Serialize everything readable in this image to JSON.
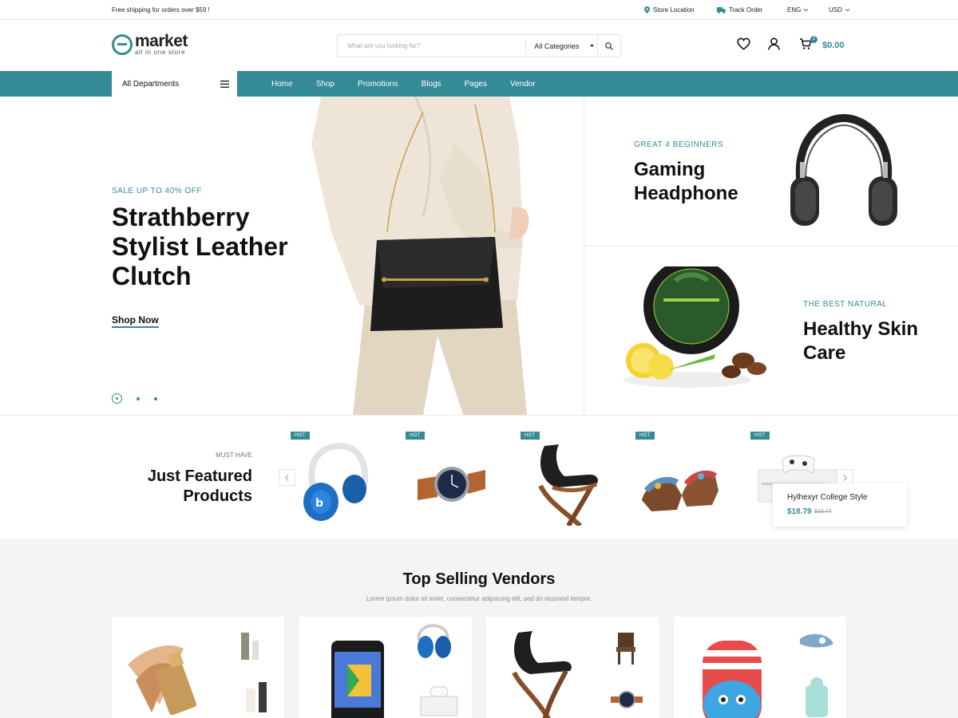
{
  "topbar": {
    "shipping": "Free shipping for orders over $59 !",
    "store_location": "Store Location",
    "track_order": "Track Order",
    "language": "ENG",
    "currency": "USD"
  },
  "header": {
    "logo_title": "market",
    "logo_sub": "all in one store",
    "search_placeholder": "What are you looking for?",
    "search_category": "All Categories",
    "cart_count": "2",
    "cart_total": "$0.00"
  },
  "nav": {
    "departments": "All Departments",
    "links": [
      "Home",
      "Shop",
      "Promotions",
      "Blogs",
      "Pages",
      "Vendor"
    ]
  },
  "hero": {
    "eyebrow": "SALE UP TO 40% OFF",
    "title": "Strathberry Stylist Leather Clutch",
    "cta": "Shop Now"
  },
  "banners": [
    {
      "eyebrow": "GREAT 4 BEGINNERS",
      "title": "Gaming Headphone"
    },
    {
      "eyebrow": "THE BEST NATURAL",
      "title": "Healthy Skin Care"
    }
  ],
  "featured": {
    "eyebrow": "MUST HAVE",
    "title": "Just Featured Products",
    "badge": "HOT",
    "products": [
      {
        "icon": "headphones-image"
      },
      {
        "icon": "watch-image"
      },
      {
        "icon": "chair-image"
      },
      {
        "icon": "sandals-image"
      },
      {
        "icon": "game-console-image"
      }
    ],
    "hover_card": {
      "name": "Hylhexyr College Style",
      "price": "$18.79",
      "old_price": "$23.74"
    }
  },
  "vendors": {
    "title": "Top Selling Vendors",
    "subtitle": "Lorem ipsum dolor sit amet, consectetur adipiscing elit, sed do eiusmod tempor."
  },
  "colors": {
    "accent": "#348a97",
    "text": "#111111",
    "muted": "#888888",
    "background_alt": "#f4f4f4"
  }
}
